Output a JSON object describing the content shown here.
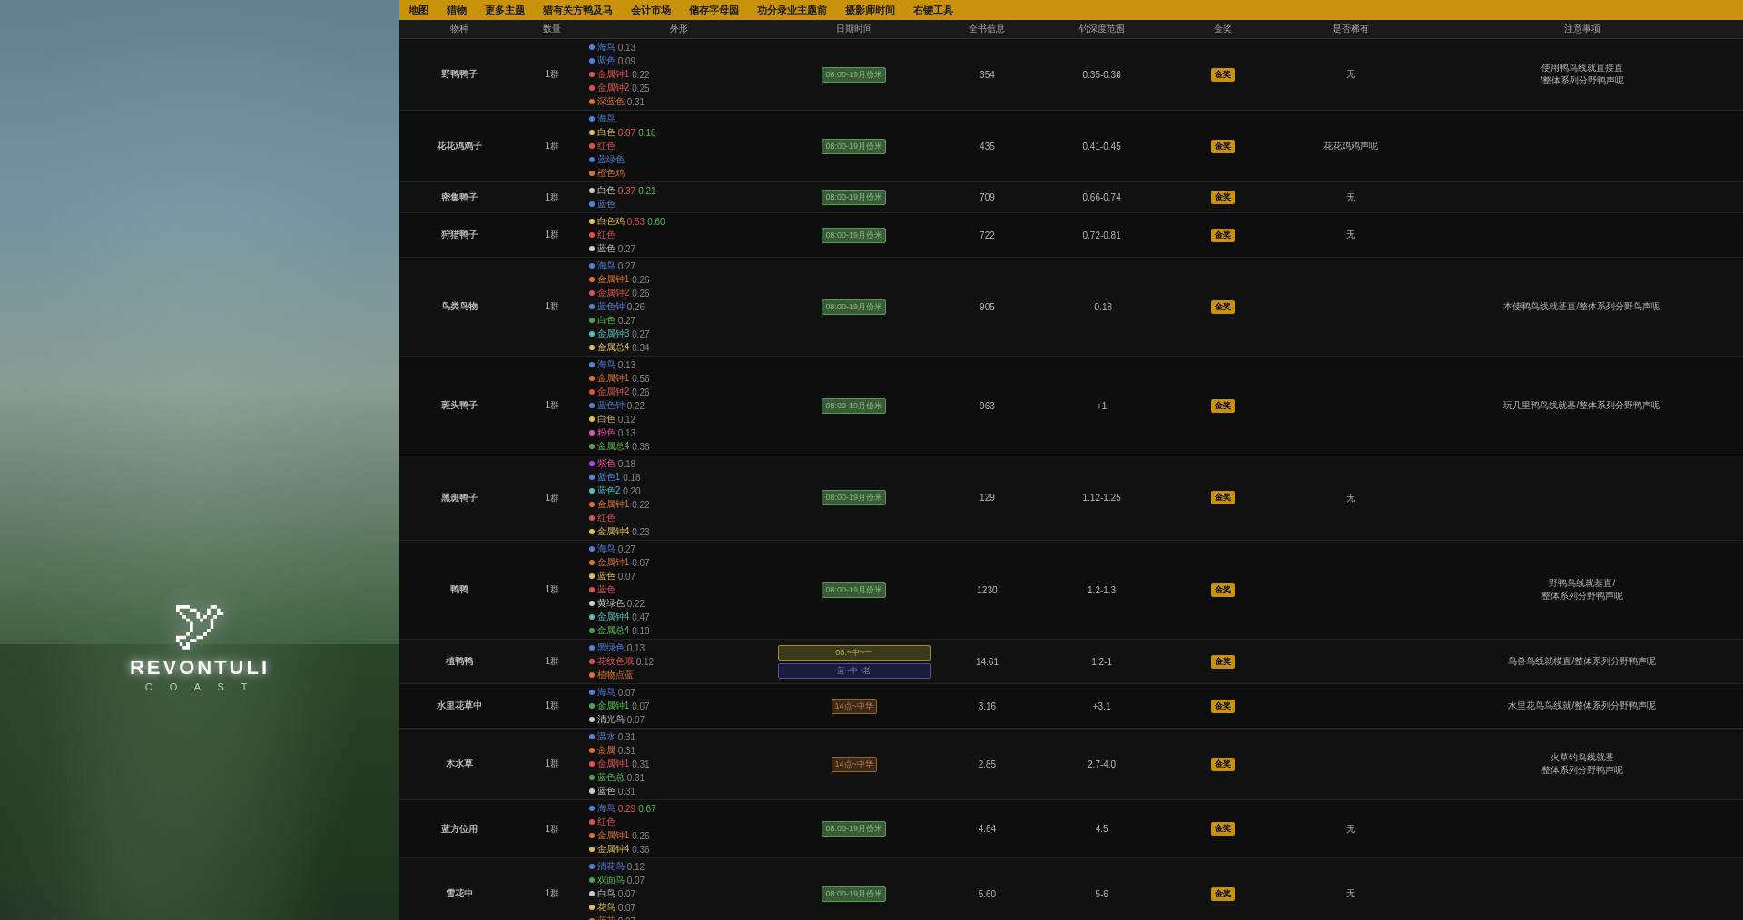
{
  "nav": {
    "items": [
      "地图",
      "猎物",
      "更多主题",
      "猎有关方鸭及马",
      "会计市场",
      "储存字母园",
      "功分录业主题前",
      "摄影师时间",
      "右键工具"
    ]
  },
  "table": {
    "headers": [
      "物种",
      "数量",
      "外形",
      "日期时间",
      "全书信息",
      "钓深度范围",
      "金奖",
      "是否稀有",
      "注意事项"
    ],
    "species": [
      {
        "name": "野鸭鸭子",
        "count": "1群",
        "colors": [
          {
            "dot": "blue",
            "text": "海鸟",
            "val": "0.13"
          },
          {
            "dot": "blue",
            "text": "蓝色",
            "val": "0.09"
          },
          {
            "dot": "red",
            "text": "金属钟1",
            "val": "0.22"
          },
          {
            "dot": "red",
            "text": "金属钟2",
            "val": "0.25"
          },
          {
            "dot": "orange",
            "text": "深蓝色",
            "val": "0.31"
          }
        ],
        "time": "08:00-19月份米",
        "count2": "354",
        "depth": "0.35-0.36",
        "award": "金奖",
        "rare": "无",
        "notes": "使用鸭鸟线就直接直/整体系列分野鸭声呢"
      }
    ]
  }
}
